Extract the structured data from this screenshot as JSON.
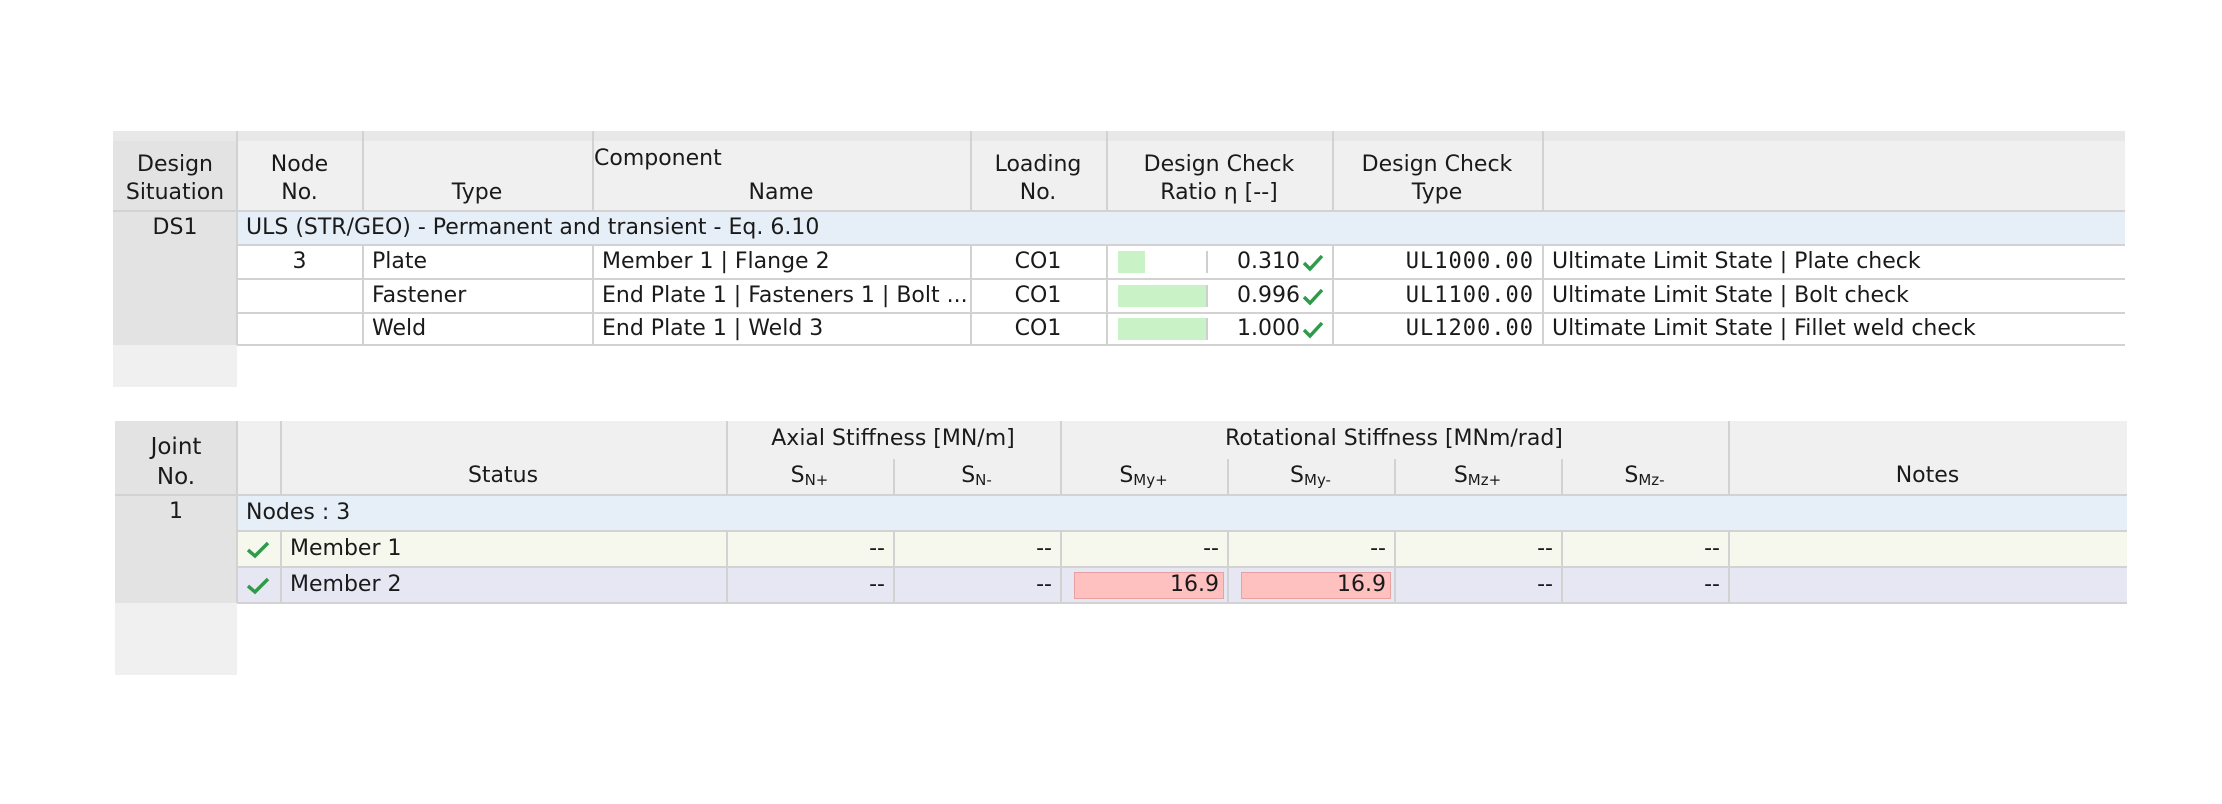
{
  "table1": {
    "headers": {
      "design_situation_1": "Design",
      "design_situation_2": "Situation",
      "node_1": "Node",
      "node_2": "No.",
      "component": "Component",
      "type": "Type",
      "name": "Name",
      "loading_1": "Loading",
      "loading_2": "No.",
      "ratio_1": "Design Check",
      "ratio_2": "Ratio η [--]",
      "check_type_1": "Design Check",
      "check_type_2": "Type"
    },
    "design_situation": "DS1",
    "group_label": "ULS (STR/GEO) - Permanent and transient - Eq. 6.10",
    "rows": [
      {
        "node": "3",
        "type": "Plate",
        "name": "Member 1 | Flange 2",
        "loading": "CO1",
        "ratio": 0.31,
        "ratio_text": "0.310",
        "code": "UL1000.00",
        "description": "Ultimate Limit State | Plate check"
      },
      {
        "node": "",
        "type": "Fastener",
        "name": "End Plate 1 | Fasteners 1 | Bolt ...",
        "loading": "CO1",
        "ratio": 0.996,
        "ratio_text": "0.996",
        "code": "UL1100.00",
        "description": "Ultimate Limit State | Bolt check"
      },
      {
        "node": "",
        "type": "Weld",
        "name": "End Plate 1 | Weld 3",
        "loading": "CO1",
        "ratio": 1.0,
        "ratio_text": "1.000",
        "code": "UL1200.00",
        "description": "Ultimate Limit State | Fillet weld check"
      }
    ]
  },
  "table2": {
    "headers": {
      "joint_1": "Joint",
      "joint_2": "No.",
      "status": "Status",
      "axial": "Axial Stiffness [MN/m]",
      "rotational": "Rotational Stiffness [MNm/rad]",
      "notes": "Notes",
      "sn_plus_base": "S",
      "sn_plus_sub": "N+",
      "sn_minus_base": "S",
      "sn_minus_sub": "N-",
      "smy_plus_base": "S",
      "smy_plus_sub": "My+",
      "smy_minus_base": "S",
      "smy_minus_sub": "My-",
      "smz_plus_base": "S",
      "smz_plus_sub": "Mz+",
      "smz_minus_base": "S",
      "smz_minus_sub": "Mz-"
    },
    "joint_no": "1",
    "group_label": "Nodes : 3",
    "rows": [
      {
        "status": "Member 1",
        "sn_plus": "--",
        "sn_minus": "--",
        "smy_plus": "--",
        "smy_minus": "--",
        "smz_plus": "--",
        "smz_minus": "--",
        "notes": ""
      },
      {
        "status": "Member 2",
        "sn_plus": "--",
        "sn_minus": "--",
        "smy_plus": "16.9",
        "smy_minus": "16.9",
        "smz_plus": "--",
        "smz_minus": "--",
        "notes": ""
      }
    ]
  },
  "colors": {
    "header_bg": "#f0f0f0",
    "left_column_bg": "#e3e3e3",
    "group_row_bg": "#e6eef7",
    "row1_bg": "#f6f8ee",
    "row2_bg": "#e7e6f3",
    "bar_fill": "#c9f2c6",
    "highlight_red": "#ffc0c0",
    "check_green": "#2e9a4a"
  }
}
